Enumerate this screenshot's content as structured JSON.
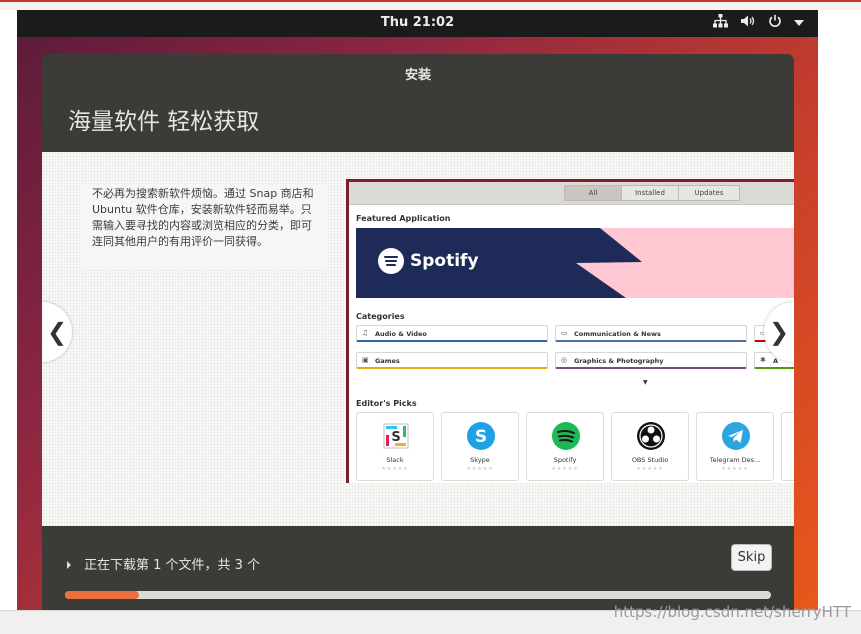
{
  "system": {
    "clock": "Thu 21:02",
    "tray_icons": [
      "network-icon",
      "volume-icon",
      "power-icon",
      "chevron-down-icon"
    ]
  },
  "installer": {
    "window_title": "安装",
    "headline": "海量软件 轻松获取",
    "description": "不必再为搜索新软件烦恼。通过 Snap 商店和 Ubuntu 软件仓库，安装新软件轻而易举。只需输入要寻找的内容或浏览相应的分类，即可连同其他用户的有用评价一同获得。",
    "prev_glyph": "❮",
    "next_glyph": "❯",
    "status_text": "正在下载第 1 个文件，共 3 个",
    "skip_label": "Skip",
    "progress_percent": 10.5
  },
  "store": {
    "tabs": [
      {
        "label": "All",
        "active": true
      },
      {
        "label": "Installed",
        "active": false
      },
      {
        "label": "Updates",
        "active": false
      }
    ],
    "featured_heading": "Featured Application",
    "featured_app": "Spotify",
    "categories_heading": "Categories",
    "categories": [
      {
        "label": "Audio & Video",
        "icon": "♫",
        "color": "#3465a4"
      },
      {
        "label": "Communication & News",
        "icon": "▭",
        "color": "#4e6f9e"
      },
      {
        "label": "",
        "icon": "▭",
        "color": "#cc0000"
      },
      {
        "label": "Games",
        "icon": "▣",
        "color": "#e6a817"
      },
      {
        "label": "Graphics & Photography",
        "icon": "◎",
        "color": "#75507b"
      },
      {
        "label": "A",
        "icon": "✱",
        "color": "#4e9a06"
      }
    ],
    "picks_heading": "Editor's Picks",
    "picks": [
      {
        "name": "Slack",
        "rating": "★★★★★"
      },
      {
        "name": "Skype",
        "rating": "★★★★★"
      },
      {
        "name": "Spotify",
        "rating": "★★★★★"
      },
      {
        "name": "OBS Studio",
        "rating": "★★★★★"
      },
      {
        "name": "Telegram Des...",
        "rating": "★★★★★"
      }
    ]
  },
  "watermark": "https://blog.csdn.net/sherryHTT",
  "colors": {
    "accent_orange": "#e9703c",
    "window_bg": "#3c3b37",
    "topbar_bg": "#1b1b1b",
    "spotify_navy": "#1e2a57",
    "spotify_pink": "#ffc8d2"
  }
}
